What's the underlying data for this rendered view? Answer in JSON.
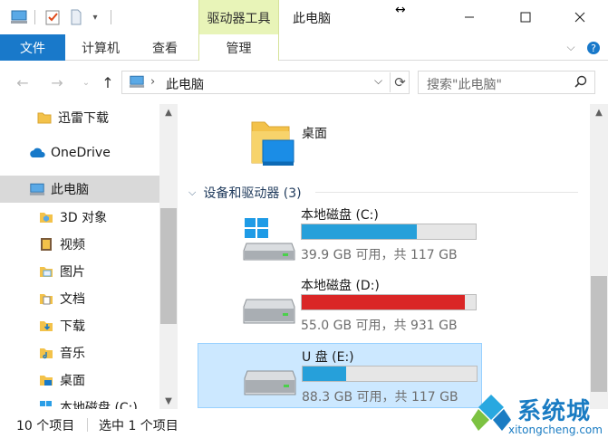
{
  "window": {
    "title": "此电脑",
    "context_tab": "驱动器工具",
    "controls": [
      "minimize",
      "maximize",
      "close"
    ]
  },
  "ribbon": {
    "tabs": [
      "文件",
      "计算机",
      "查看",
      "管理"
    ],
    "collapse_icon": "chevron-down-icon",
    "help_icon": "help-icon"
  },
  "address": {
    "path": "此电脑",
    "search_placeholder": "搜索\"此电脑\""
  },
  "nav_pane": {
    "items": [
      {
        "label": "迅雷下载",
        "icon": "folder-icon"
      },
      {
        "label": "OneDrive",
        "icon": "cloud-icon"
      },
      {
        "label": "此电脑",
        "icon": "computer-icon",
        "selected": true
      },
      {
        "label": "3D 对象",
        "icon": "3d-objects-icon"
      },
      {
        "label": "视频",
        "icon": "video-folder-icon"
      },
      {
        "label": "图片",
        "icon": "pictures-folder-icon"
      },
      {
        "label": "文档",
        "icon": "documents-folder-icon"
      },
      {
        "label": "下载",
        "icon": "downloads-folder-icon"
      },
      {
        "label": "音乐",
        "icon": "music-folder-icon"
      },
      {
        "label": "桌面",
        "icon": "desktop-folder-icon"
      },
      {
        "label": "本地磁盘 (C:)",
        "icon": "drive-icon"
      }
    ]
  },
  "content": {
    "folder": {
      "label": "桌面"
    },
    "group_header": "设备和驱动器 (3)",
    "drives": [
      {
        "name": "本地磁盘 (C:)",
        "free": "39.9 GB 可用，共 117 GB",
        "used_fraction": 0.66,
        "bar_color": "#26a0da",
        "selected": false,
        "windows_logo": true
      },
      {
        "name": "本地磁盘 (D:)",
        "free": "55.0 GB 可用，共 931 GB",
        "used_fraction": 0.94,
        "bar_color": "#da2626",
        "selected": false,
        "windows_logo": false
      },
      {
        "name": "U 盘 (E:)",
        "free": "88.3 GB 可用，共 117 GB",
        "used_fraction": 0.25,
        "bar_color": "#26a0da",
        "selected": true,
        "windows_logo": false
      }
    ]
  },
  "status": {
    "count": "10 个项目",
    "selected": "选中 1 个项目"
  },
  "watermark": {
    "name": "系统城",
    "url": "xitongcheng.com"
  },
  "colors": {
    "accent": "#1979ca",
    "context_tab": "#e8f4b8",
    "selection": "#cce8ff"
  }
}
